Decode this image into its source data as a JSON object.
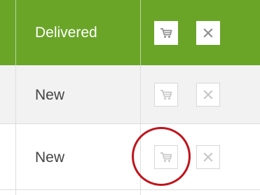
{
  "colors": {
    "header_green": "#6aa528",
    "annotation_red": "#c0141c"
  },
  "rows": [
    {
      "status": "Delivered",
      "actions": [
        {
          "icon": "cart-icon",
          "disabled": false
        },
        {
          "icon": "close-icon",
          "disabled": false
        }
      ]
    },
    {
      "status": "New",
      "actions": [
        {
          "icon": "cart-icon",
          "disabled": true
        },
        {
          "icon": "close-icon",
          "disabled": true
        }
      ]
    },
    {
      "status": "New",
      "actions": [
        {
          "icon": "cart-icon",
          "disabled": true,
          "highlighted": true
        },
        {
          "icon": "close-icon",
          "disabled": true
        }
      ]
    }
  ]
}
